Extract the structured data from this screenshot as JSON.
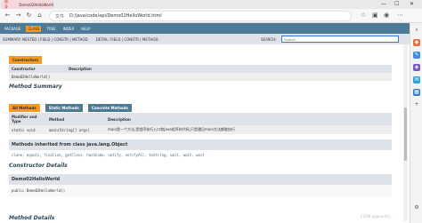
{
  "browser": {
    "tab_title": "Demo02HelloWorld",
    "tab_badge": "隐身",
    "url_prefix": "文件",
    "url": "D:/java/code/api/Demo02HelloWorld.html",
    "controls": {
      "minimize": "—",
      "maximize": "☐",
      "close": "✕"
    }
  },
  "topnav": {
    "items": [
      "PACKAGE",
      "CLASS",
      "TREE",
      "INDEX",
      "HELP"
    ],
    "active": "CLASS"
  },
  "subnav": {
    "left": "SUMMARY: NESTED | FIELD | CONSTR | METHOD",
    "right": "DETAIL: FIELD | CONSTR | METHOD",
    "search_label": "SEARCH:",
    "search_placeholder": "Search"
  },
  "constructors_summary": {
    "caption": "Constructors",
    "headers": [
      "Constructor",
      "Description"
    ],
    "rows": [
      [
        "Demo02HelloWorld()",
        ""
      ]
    ]
  },
  "method_summary": {
    "title": "Method Summary",
    "tabs": [
      "All Methods",
      "Static Methods",
      "Concrete Methods"
    ],
    "active_tab": "All Methods",
    "headers": [
      "Modifier and Type",
      "Method",
      "Description"
    ],
    "rows": [
      {
        "modifier": "static void",
        "method": "main(String[] args)",
        "desc": "main是一个方法,是程序执行入口和Java程序的代码,只是遇见main方法都能执行"
      }
    ],
    "inherited_title": "Methods inherited from class java.lang.Object",
    "inherited_list": "clone, equals, finalize, getClass, hashCode, notify, notifyAll, toString, wait, wait, wait"
  },
  "constructor_details": {
    "title": "Constructor Details",
    "name": "Demo02HelloWorld",
    "signature": "public Demo02HelloWorld()"
  },
  "method_details": {
    "title": "Method Details"
  },
  "watermark": "CSDN @Java小白..."
}
